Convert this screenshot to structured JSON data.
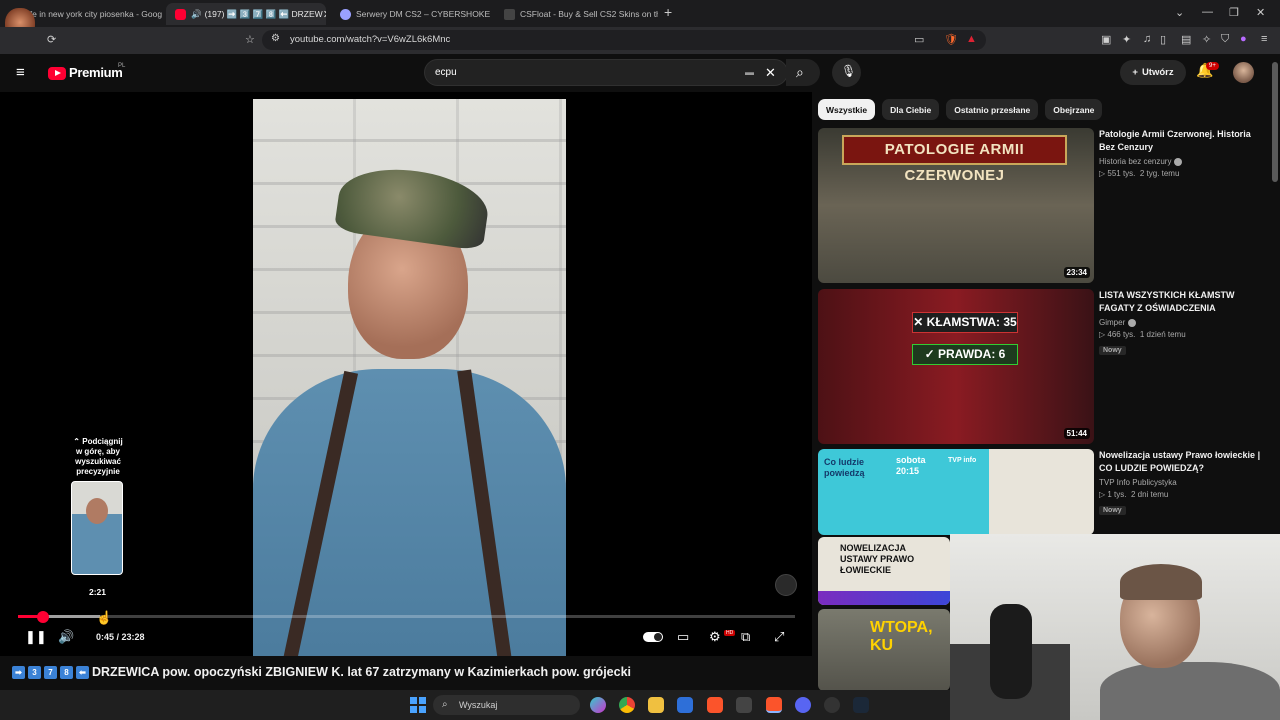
{
  "browser": {
    "tabs": [
      {
        "label": "life in new york city piosenka - Goog",
        "active": false
      },
      {
        "label": "(197) ➡️ 3️⃣ 7️⃣ 8️⃣ ⬅️ DRZEW",
        "active": true
      },
      {
        "label": "Serwery DM CS2 – CYBERSHOKE",
        "active": false
      },
      {
        "label": "CSFloat - Buy & Sell CS2 Skins on the",
        "active": false
      }
    ],
    "new_tab": "+",
    "url": "youtube.com/watch?v=V6wZL6k6Mnc"
  },
  "overlay": {
    "badge": "x14"
  },
  "youtube": {
    "brand": "Premium",
    "country": "PL",
    "search_value": "ecpu",
    "create_label": "Utwórz",
    "notifications": "9+"
  },
  "player": {
    "preview_hint": "Podciągnij w górę, aby wyszukiwać precyzyjnie",
    "preview_time": "2:21",
    "time_current": "0:45",
    "time_total": "23:28",
    "progress_played_fraction": 0.032,
    "buffered_fraction": 0.105,
    "hd_badge": "HD"
  },
  "video": {
    "title_emojis": [
      "3",
      "7",
      "8"
    ],
    "title": "DRZEWICA pow. opoczyński ZBIGNIEW K. lat 67 zatrzymany w Kazimierkach pow. grójecki"
  },
  "chips": [
    "Wszystkie",
    "Dla Ciebie",
    "Ostatnio przesłane",
    "Obejrzane"
  ],
  "recommendations": [
    {
      "title": "Patologie Armii Czerwonej. Historia Bez Cenzury",
      "channel": "Historia bez cenzury",
      "views": "551 tys.",
      "age": "2 tyg. temu",
      "duration": "23:34",
      "thumb_text": "PATOLOGIE ARMII CZERWONEJ",
      "badge": ""
    },
    {
      "title": "LISTA WSZYSTKICH KŁAMSTW FAGATY Z OŚWIADCZENIA",
      "channel": "Gimper",
      "views": "466 tys.",
      "age": "1 dzień temu",
      "duration": "51:44",
      "thumb_lie": "✕ KŁAMSTWA: 35",
      "thumb_truth": "✓ PRAWDA: 6",
      "badge": "Nowy"
    },
    {
      "title": "Nowelizacja ustawy Prawo łowieckie | CO LUDZIE POWIEDZĄ?",
      "channel": "TVP Info Publicystyka",
      "views": "1 tys.",
      "age": "2 dni temu",
      "thumb_text": "Co ludzie powiedzą",
      "thumb_time": "sobota 20:15",
      "thumb_brand": "TVP info",
      "badge": "Nowy"
    }
  ],
  "partial_recs": [
    {
      "thumb_text": "NOWELIZACJA USTAWY PRAWO ŁOWIECKIE"
    },
    {
      "thumb_text": "WTOPA, KU"
    }
  ],
  "taskbar": {
    "search_placeholder": "Wyszukaj"
  }
}
